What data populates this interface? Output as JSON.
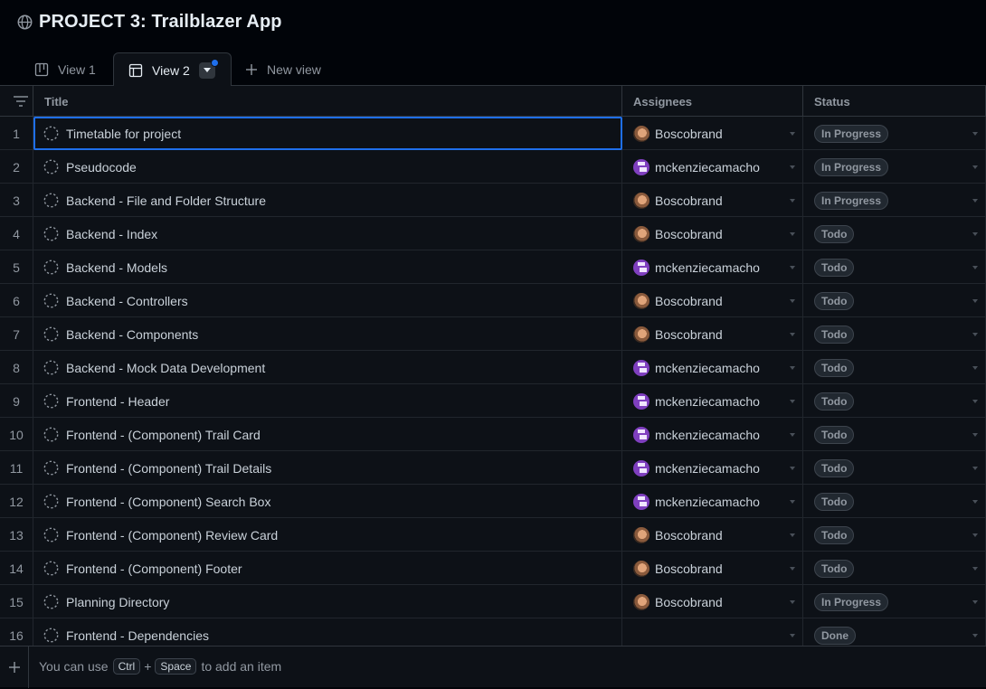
{
  "project": {
    "title": "PROJECT 3: Trailblazer App"
  },
  "tabs": [
    {
      "label": "View 1"
    },
    {
      "label": "View 2"
    },
    {
      "label": "New view"
    }
  ],
  "columns": {
    "title": "Title",
    "assignees": "Assignees",
    "status": "Status"
  },
  "rows": [
    {
      "num": "1",
      "title": "Timetable for project",
      "assignee": "Boscobrand",
      "avatar": "bosco",
      "status": "In Progress"
    },
    {
      "num": "2",
      "title": "Pseudocode",
      "assignee": "mckenziecamacho",
      "avatar": "mck",
      "status": "In Progress"
    },
    {
      "num": "3",
      "title": "Backend - File and Folder Structure",
      "assignee": "Boscobrand",
      "avatar": "bosco",
      "status": "In Progress"
    },
    {
      "num": "4",
      "title": "Backend - Index",
      "assignee": "Boscobrand",
      "avatar": "bosco",
      "status": "Todo"
    },
    {
      "num": "5",
      "title": "Backend - Models",
      "assignee": "mckenziecamacho",
      "avatar": "mck",
      "status": "Todo"
    },
    {
      "num": "6",
      "title": "Backend - Controllers",
      "assignee": "Boscobrand",
      "avatar": "bosco",
      "status": "Todo"
    },
    {
      "num": "7",
      "title": "Backend - Components",
      "assignee": "Boscobrand",
      "avatar": "bosco",
      "status": "Todo"
    },
    {
      "num": "8",
      "title": "Backend - Mock Data Development",
      "assignee": "mckenziecamacho",
      "avatar": "mck",
      "status": "Todo"
    },
    {
      "num": "9",
      "title": "Frontend - Header",
      "assignee": "mckenziecamacho",
      "avatar": "mck",
      "status": "Todo"
    },
    {
      "num": "10",
      "title": "Frontend - (Component) Trail Card",
      "assignee": "mckenziecamacho",
      "avatar": "mck",
      "status": "Todo"
    },
    {
      "num": "11",
      "title": "Frontend - (Component) Trail Details",
      "assignee": "mckenziecamacho",
      "avatar": "mck",
      "status": "Todo"
    },
    {
      "num": "12",
      "title": "Frontend - (Component) Search Box",
      "assignee": "mckenziecamacho",
      "avatar": "mck",
      "status": "Todo"
    },
    {
      "num": "13",
      "title": "Frontend - (Component) Review Card",
      "assignee": "Boscobrand",
      "avatar": "bosco",
      "status": "Todo"
    },
    {
      "num": "14",
      "title": "Frontend - (Component) Footer",
      "assignee": "Boscobrand",
      "avatar": "bosco",
      "status": "Todo"
    },
    {
      "num": "15",
      "title": "Planning Directory",
      "assignee": "Boscobrand",
      "avatar": "bosco",
      "status": "In Progress"
    },
    {
      "num": "16",
      "title": "Frontend - Dependencies",
      "assignee": "",
      "avatar": "",
      "status": "Done"
    }
  ],
  "footer": {
    "hint_before": "You can use",
    "key_ctrl": "Ctrl",
    "plus": "+",
    "key_space": "Space",
    "hint_after": "to add an item"
  },
  "icons": {
    "project": "globe-icon",
    "view1": "board-icon",
    "view2": "table-icon",
    "new_view": "plus-icon",
    "filter": "filter-icon",
    "item": "draft-issue-icon"
  },
  "colors": {
    "background": "#0d1117",
    "selection": "#1f6feb",
    "notification_dot": "#1f6feb"
  }
}
